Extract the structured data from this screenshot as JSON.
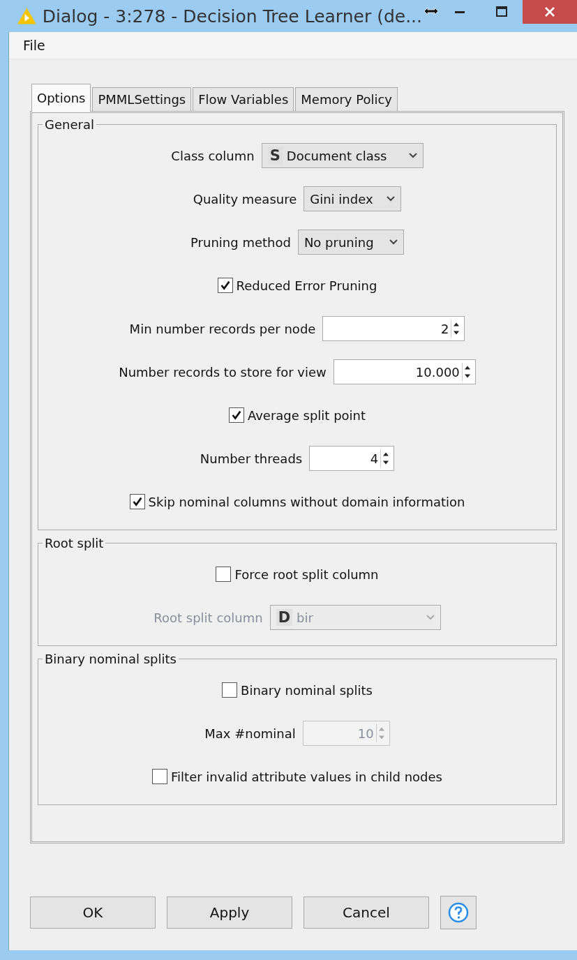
{
  "window": {
    "title": "Dialog - 3:278 - Decision Tree Learner (de..."
  },
  "menu": [
    "File"
  ],
  "tabs": [
    {
      "label": "Options",
      "selected": true
    },
    {
      "label": "PMMLSettings",
      "selected": false
    },
    {
      "label": "Flow Variables",
      "selected": false
    },
    {
      "label": "Memory Policy",
      "selected": false
    }
  ],
  "sections": [
    {
      "title": "General",
      "rows": [
        {
          "kind": "dropdown",
          "label": "Class column",
          "type_badge": "S",
          "value": "Document class",
          "disabled": false
        },
        {
          "kind": "dropdown",
          "label": "Quality measure",
          "value": "Gini index",
          "disabled": false
        },
        {
          "kind": "dropdown",
          "label": "Pruning method",
          "value": "No pruning",
          "disabled": false
        },
        {
          "kind": "checkbox",
          "label": "Reduced Error Pruning",
          "checked": true
        },
        {
          "kind": "spinner",
          "label": "Min number records per node",
          "value": "2",
          "disabled": false
        },
        {
          "kind": "spinner",
          "label": "Number records to store for view",
          "value": "10.000",
          "disabled": false
        },
        {
          "kind": "checkbox",
          "label": "Average split point",
          "checked": true
        },
        {
          "kind": "spinner",
          "label": "Number threads",
          "value": "4",
          "disabled": false
        },
        {
          "kind": "checkbox",
          "label": "Skip nominal columns without domain information",
          "checked": true
        }
      ]
    },
    {
      "title": "Root split",
      "rows": [
        {
          "kind": "checkbox",
          "label": "Force root split column",
          "checked": false
        },
        {
          "kind": "dropdown",
          "label": "Root split column",
          "type_badge": "D",
          "value": "bir",
          "disabled": true
        }
      ]
    },
    {
      "title": "Binary nominal splits",
      "rows": [
        {
          "kind": "checkbox",
          "label": "Binary nominal splits",
          "checked": false
        },
        {
          "kind": "spinner",
          "label": "Max #nominal",
          "value": "10",
          "disabled": true
        },
        {
          "kind": "checkbox",
          "label": "Filter invalid attribute values in child nodes",
          "checked": false
        }
      ]
    }
  ],
  "buttons": [
    "OK",
    "Apply",
    "Cancel"
  ]
}
